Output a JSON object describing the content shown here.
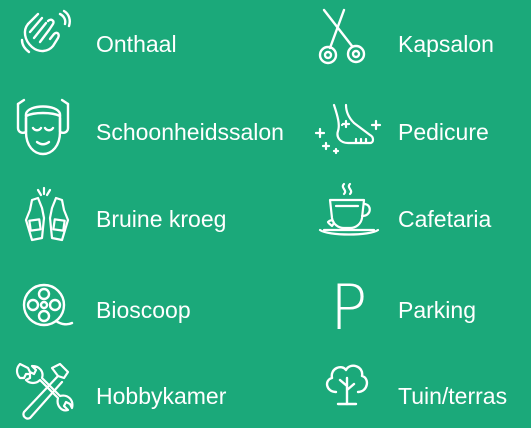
{
  "colors": {
    "background": "#1ba97a",
    "foreground": "#ffffff"
  },
  "facilities": [
    {
      "label": "Onthaal",
      "icon": "waving-hand-icon"
    },
    {
      "label": "Kapsalon",
      "icon": "scissors-icon"
    },
    {
      "label": "Schoonheidssalon",
      "icon": "face-mask-icon"
    },
    {
      "label": "Pedicure",
      "icon": "foot-sparkle-icon"
    },
    {
      "label": "Bruine kroeg",
      "icon": "beer-bottles-icon"
    },
    {
      "label": "Cafetaria",
      "icon": "coffee-cup-icon"
    },
    {
      "label": "Bioscoop",
      "icon": "film-reel-icon"
    },
    {
      "label": "Parking",
      "icon": "parking-icon",
      "glyph": "P"
    },
    {
      "label": "Hobbykamer",
      "icon": "tools-icon"
    },
    {
      "label": "Tuin/terras",
      "icon": "tree-icon"
    }
  ]
}
